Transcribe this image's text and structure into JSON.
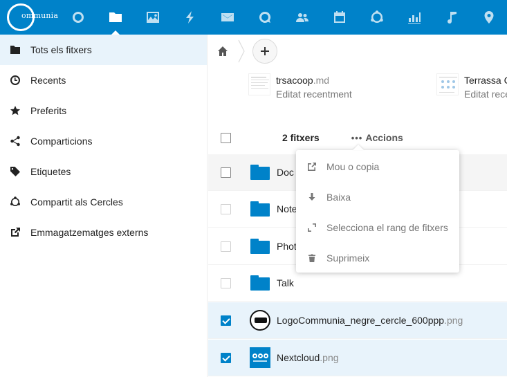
{
  "brand": {
    "logo_text": "ommunia",
    "accent": "#0082c9"
  },
  "header": {
    "apps": [
      {
        "icon": "dashboard-circle-icon",
        "name": "app-dashboard"
      },
      {
        "icon": "folder-icon",
        "name": "app-files",
        "active": true
      },
      {
        "icon": "image-icon",
        "name": "app-photos"
      },
      {
        "icon": "lightning-icon",
        "name": "app-activity"
      },
      {
        "icon": "mail-icon",
        "name": "app-mail"
      },
      {
        "icon": "talk-icon",
        "name": "app-talk"
      },
      {
        "icon": "contacts-icon",
        "name": "app-contacts"
      },
      {
        "icon": "calendar-icon",
        "name": "app-calendar"
      },
      {
        "icon": "circles-icon",
        "name": "app-circles"
      },
      {
        "icon": "chart-icon",
        "name": "app-analytics"
      },
      {
        "icon": "music-icon",
        "name": "app-music"
      },
      {
        "icon": "map-pin-icon",
        "name": "app-maps"
      }
    ]
  },
  "sidebar": {
    "items": [
      {
        "label": "Tots els fitxers",
        "icon": "folder-icon",
        "active": true
      },
      {
        "label": "Recents",
        "icon": "clock-icon"
      },
      {
        "label": "Preferits",
        "icon": "star-icon"
      },
      {
        "label": "Comparticions",
        "icon": "share-icon"
      },
      {
        "label": "Etiquetes",
        "icon": "tag-icon"
      },
      {
        "label": "Compartit als Cercles",
        "icon": "circles-icon"
      },
      {
        "label": "Emmagatzematges externs",
        "icon": "external-link-icon"
      }
    ]
  },
  "recent": [
    {
      "name": "trsacoop",
      "ext": ".md",
      "sub": "Editat recentment"
    },
    {
      "name": "Terrassa C",
      "ext": "",
      "sub": "Editat recentment"
    }
  ],
  "list": {
    "count_label": "2 fitxers",
    "actions_dots": "•••",
    "actions_label": "Accions",
    "files": [
      {
        "name": "Doc",
        "ext": "",
        "type": "folder",
        "checked": false,
        "state": "hover"
      },
      {
        "name": "Note",
        "ext": "",
        "type": "folder",
        "checked": false,
        "state": ""
      },
      {
        "name": "Phot",
        "ext": "",
        "type": "folder",
        "checked": false,
        "state": ""
      },
      {
        "name": "Talk",
        "ext": "",
        "type": "folder",
        "checked": false,
        "state": ""
      },
      {
        "name": "LogoCommunia_negre_cercle_600ppp",
        "ext": ".png",
        "type": "logo",
        "checked": true,
        "state": "selected"
      },
      {
        "name": "Nextcloud",
        "ext": ".png",
        "type": "nextcloud",
        "checked": true,
        "state": "selected"
      }
    ]
  },
  "menu": {
    "items": [
      {
        "label": "Mou o copia",
        "icon": "external-link-icon"
      },
      {
        "label": "Baixa",
        "icon": "download-icon"
      },
      {
        "label": "Selecciona el rang de fitxers",
        "icon": "range-select-icon"
      },
      {
        "label": "Suprimeix",
        "icon": "trash-icon"
      }
    ]
  }
}
